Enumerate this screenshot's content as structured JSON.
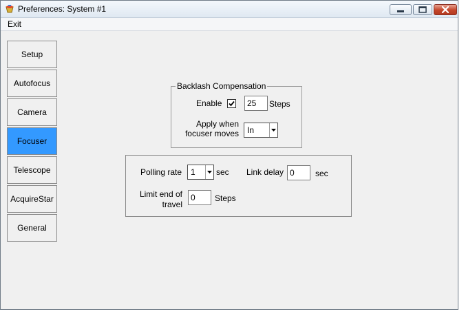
{
  "window": {
    "title": "Preferences: System #1"
  },
  "menu": {
    "exit_label": "Exit"
  },
  "nav": {
    "items": [
      {
        "label": "Setup",
        "name": "setup"
      },
      {
        "label": "Autofocus",
        "name": "autofocus"
      },
      {
        "label": "Camera",
        "name": "camera"
      },
      {
        "label": "Focuser",
        "name": "focuser",
        "selected": true
      },
      {
        "label": "Telescope",
        "name": "telescope"
      },
      {
        "label": "AcquireStar",
        "name": "acquirestar"
      },
      {
        "label": "General",
        "name": "general"
      }
    ],
    "selected_color": "#3399ff"
  },
  "backlash": {
    "legend": "Backlash Compensation",
    "enable_label": "Enable",
    "enabled": true,
    "steps_value": "25",
    "steps_unit": "Steps",
    "apply_label_line1": "Apply when",
    "apply_label_line2": "focuser moves",
    "apply_value": "In"
  },
  "polling": {
    "polling_label": "Polling rate",
    "polling_value": "1",
    "polling_unit": "sec",
    "link_delay_label": "Link delay",
    "link_delay_value": "0",
    "link_delay_unit": "sec",
    "limit_label_line1": "Limit end of",
    "limit_label_line2": "travel",
    "limit_value": "0",
    "limit_unit": "Steps"
  },
  "icons": {
    "app": "app-icon",
    "minimize": "minimize-icon",
    "maximize": "maximize-icon",
    "close": "close-icon",
    "checkmark": "checkmark-icon",
    "dropdown": "chevron-down-icon"
  }
}
